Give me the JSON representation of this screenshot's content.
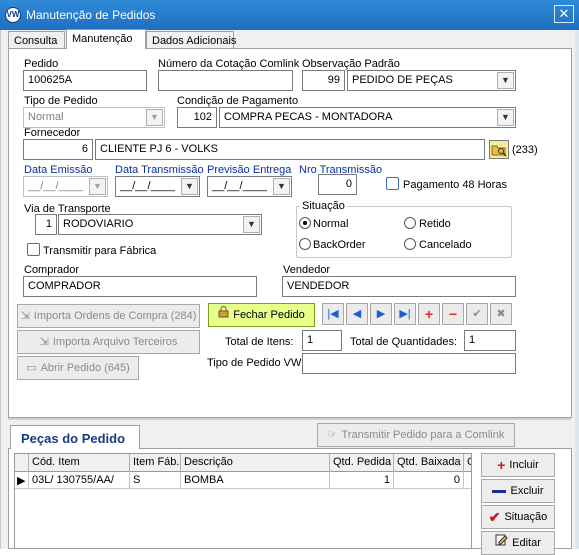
{
  "window": {
    "title": "Manutenção de Pedidos",
    "logo": "VW",
    "close": "✕"
  },
  "tabs": [
    {
      "label": "Consulta"
    },
    {
      "label": "Manutenção"
    },
    {
      "label": "Dados Adicionais"
    }
  ],
  "form": {
    "pedido": {
      "label": "Pedido",
      "value": "100625A"
    },
    "numero_cotacao": {
      "label": "Número da Cotação Comlink",
      "value": ""
    },
    "observacao": {
      "label": "Observação Padrão",
      "code": "99",
      "value": "PEDIDO DE PEÇAS"
    },
    "tipo_pedido": {
      "label": "Tipo de Pedido",
      "value": "Normal"
    },
    "condicao_pagamento": {
      "label": "Condição de Pagamento",
      "code": "102",
      "value": "COMPRA PECAS - MONTADORA"
    },
    "fornecedor": {
      "label": "Fornecedor",
      "code": "6",
      "value": "CLIENTE PJ 6 - VOLKS",
      "count": "(233)"
    },
    "data_emissao": {
      "label": "Data Emissão",
      "value": "__/__/____"
    },
    "data_transmissao": {
      "label": "Data Transmissão",
      "value": "__/__/____"
    },
    "previsao_entrega": {
      "label": "Previsão Entrega",
      "value": "__/__/____"
    },
    "nro_transmissao": {
      "label": "Nro Transmissão",
      "value": "0"
    },
    "pagamento48": {
      "label": "Pagamento 48 Horas"
    },
    "via_transporte": {
      "label": "Via de Transporte",
      "code": "1",
      "value": "RODOVIARIO"
    },
    "situacao": {
      "label": "Situação",
      "options": [
        "Normal",
        "Retido",
        "BackOrder",
        "Cancelado"
      ],
      "selected": "Normal"
    },
    "transmitir_fabrica": {
      "label": "Transmitir para Fábrica"
    },
    "comprador": {
      "label": "Comprador",
      "value": "COMPRADOR"
    },
    "vendedor": {
      "label": "Vendedor",
      "value": "VENDEDOR"
    },
    "total_itens": {
      "label": "Total de Itens:",
      "value": "1"
    },
    "total_quantidades": {
      "label": "Total de Quantidades:",
      "value": "1"
    },
    "tipo_pedido_vw": {
      "label": "Tipo de Pedido VW",
      "value": ""
    }
  },
  "buttons": {
    "importa_ordens": "Importa Ordens de Compra (284)",
    "fechar_pedido": "Fechar Pedido",
    "importa_arquivo": "Importa Arquivo Terceiros",
    "abrir_pedido": "Abrir Pedido (645)",
    "transmitir_comlink": "Transmitir Pedido para a Comlink"
  },
  "nav": {
    "first": "|◀",
    "prev": "◀",
    "next": "▶",
    "last": "▶|",
    "add": "+",
    "remove": "−",
    "confirm": "✔",
    "cancel": "✖"
  },
  "pecas": {
    "tab_label": "Peças do Pedido",
    "columns": [
      "Cód. Item",
      "Item Fáb.",
      "Descrição",
      "Qtd. Pedida",
      "Qtd. Baixada",
      "C"
    ],
    "rows": [
      {
        "marker": "▶",
        "cod_item": "03L/ 130755/AA/",
        "item_fab": "S",
        "descricao": "BOMBA",
        "qtd_pedida": "1",
        "qtd_baixada": "0",
        "c": ""
      }
    ]
  },
  "side_buttons": {
    "incluir": "Incluir",
    "excluir": "Excluir",
    "situacao": "Situação",
    "editar": "Editar"
  },
  "colors": {
    "title_bar": "#1f6fc0",
    "accent_green": "#e8ff8a",
    "label_blue": "#0a2f9e"
  }
}
